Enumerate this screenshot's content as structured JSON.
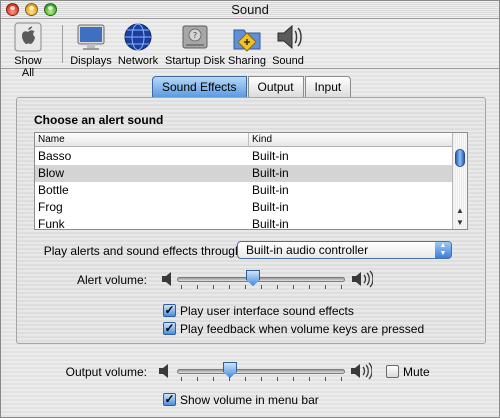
{
  "window": {
    "title": "Sound"
  },
  "toolbar": {
    "items": [
      {
        "label": "Show All",
        "icon": "apple-show-all-icon"
      },
      {
        "label": "Displays",
        "icon": "displays-icon"
      },
      {
        "label": "Network",
        "icon": "network-globe-icon"
      },
      {
        "label": "Startup Disk",
        "icon": "startup-disk-icon"
      },
      {
        "label": "Sharing",
        "icon": "sharing-folder-icon"
      },
      {
        "label": "Sound",
        "icon": "speaker-icon"
      }
    ]
  },
  "tabs": [
    {
      "label": "Sound Effects",
      "active": true
    },
    {
      "label": "Output",
      "active": false
    },
    {
      "label": "Input",
      "active": false
    }
  ],
  "sound_effects": {
    "heading": "Choose an alert sound",
    "columns": {
      "name": "Name",
      "kind": "Kind"
    },
    "rows": [
      {
        "name": "Basso",
        "kind": "Built-in",
        "selected": false
      },
      {
        "name": "Blow",
        "kind": "Built-in",
        "selected": true
      },
      {
        "name": "Bottle",
        "kind": "Built-in",
        "selected": false
      },
      {
        "name": "Frog",
        "kind": "Built-in",
        "selected": false
      },
      {
        "name": "Funk",
        "kind": "Built-in",
        "selected": false
      }
    ],
    "play_through_label": "Play alerts and sound effects through:",
    "play_through_value": "Built-in audio controller",
    "alert_volume_label": "Alert volume:",
    "alert_volume": 0.45,
    "ui_effects_label": "Play user interface sound effects",
    "ui_effects_checked": true,
    "feedback_label": "Play feedback when volume keys are pressed",
    "feedback_checked": true
  },
  "output": {
    "volume_label": "Output volume:",
    "volume": 0.3,
    "mute_label": "Mute",
    "mute_checked": false,
    "menu_bar_label": "Show volume in menu bar",
    "menu_bar_checked": true
  },
  "colors": {
    "accent_blue": "#4a8ee0",
    "selection_gray": "#d4d4d4"
  }
}
